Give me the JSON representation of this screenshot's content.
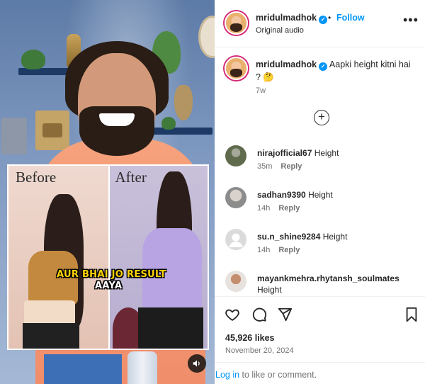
{
  "header": {
    "username": "mridulmadhok",
    "separator": "•",
    "follow_label": "Follow",
    "audio_label": "Original audio",
    "more_label": "•••"
  },
  "media": {
    "before_label": "Before",
    "after_label": "After",
    "caption_line1": "AUR BHAI JO RESULT",
    "caption_line2": "AAYA",
    "mute_icon": "speaker-icon"
  },
  "caption": {
    "username": "mridulmadhok",
    "text": "Aapki height kitni hai ? 🤔",
    "time": "7w"
  },
  "load_more_label": "+",
  "comments": [
    {
      "username": "nirajofficial67",
      "text": "Height",
      "time": "35m",
      "reply_label": "Reply"
    },
    {
      "username": "sadhan9390",
      "text": "Height",
      "time": "14h",
      "reply_label": "Reply"
    },
    {
      "username": "su.n_shine9284",
      "text": "Height",
      "time": "14h",
      "reply_label": "Reply"
    },
    {
      "username": "mayankmehra.rhytansh_soulmates",
      "text": "Height",
      "time": "",
      "reply_label": ""
    }
  ],
  "actions": {
    "likes": "45,926 likes",
    "date": "November 20, 2024",
    "login_link": "Log in",
    "login_rest": " to like or comment."
  },
  "colors": {
    "accent_blue": "#0095f6",
    "text_primary": "#262626",
    "text_secondary": "#737373",
    "caption_yellow": "#ffd400"
  }
}
